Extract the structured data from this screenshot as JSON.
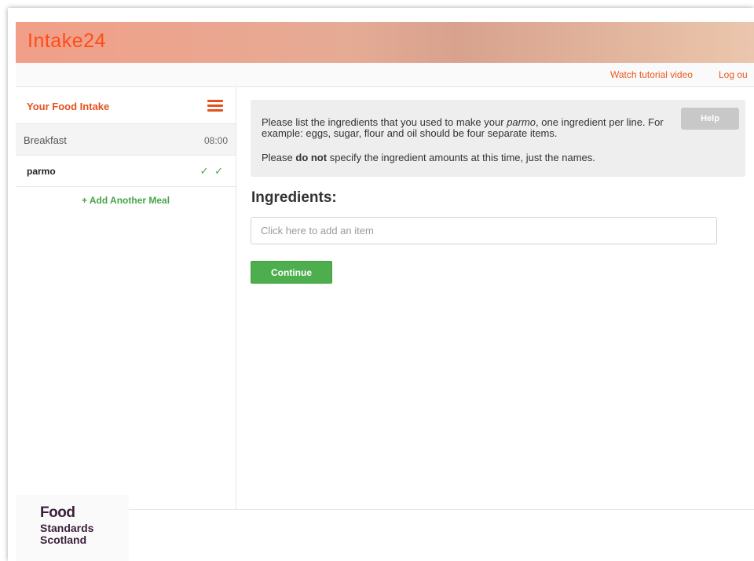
{
  "app": {
    "title": "Intake24"
  },
  "topbar": {
    "watch_tutorial": "Watch tutorial video",
    "logout": "Log ou"
  },
  "sidebar": {
    "title": "Your Food Intake",
    "menu_icon": "hamburger-menu-icon",
    "meals": [
      {
        "name": "Breakfast",
        "time": "08:00"
      },
      {
        "name": "parmo",
        "status": "✓ ✓"
      }
    ],
    "add_meal": "+ Add Another Meal"
  },
  "prompt": {
    "line1_before": "Please list the ingredients that you used to make your ",
    "line1_food": "parmo",
    "line1_after": ", one ingredient per line. For example: eggs, sugar, flour and oil should be four separate items.",
    "line2_before": "Please ",
    "line2_bold": "do not",
    "line2_after": " specify the ingredient amounts at this time, just the names.",
    "help_label": "Help"
  },
  "ingredients": {
    "title": "Ingredients:",
    "placeholder": "Click here to add an item",
    "value": ""
  },
  "continue_label": "Continue",
  "logo": {
    "line1": "Food",
    "line2": "Standards",
    "line3": "Scotland"
  },
  "colors": {
    "brand": "#ff4d1a",
    "accent": "#e5511d",
    "success": "#4cae4c"
  }
}
